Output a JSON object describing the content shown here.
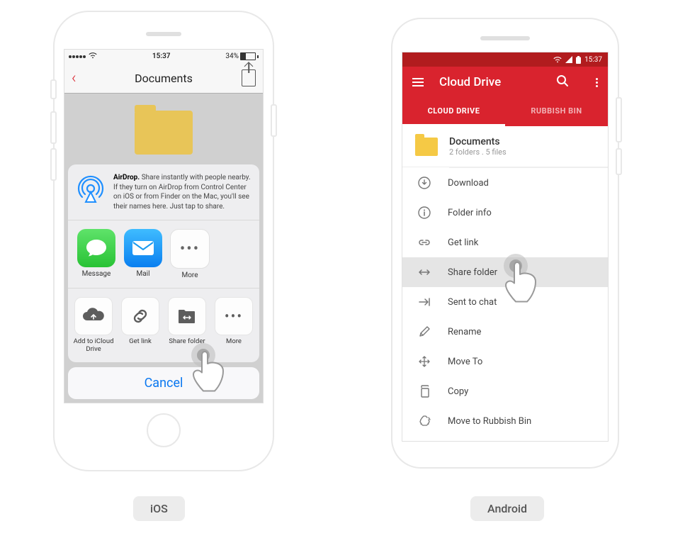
{
  "ios": {
    "status": {
      "time": "15:37",
      "battery": "34%"
    },
    "nav_title": "Documents",
    "airdrop": {
      "bold": "AirDrop.",
      "text": " Share instantly with people nearby. If they turn on AirDrop from Control Center on iOS or from Finder on the Mac, you'll see their names here. Just tap to share."
    },
    "apps": {
      "message": "Message",
      "mail": "Mail",
      "more": "More"
    },
    "actions": {
      "icloud": "Add to iCloud Drive",
      "getlink": "Get link",
      "sharefolder": "Share folder",
      "more": "More"
    },
    "cancel": "Cancel"
  },
  "android": {
    "status_time": "15:37",
    "toolbar_title": "Cloud Drive",
    "tabs": {
      "cloud": "CLOUD DRIVE",
      "rubbish": "RUBBISH BIN"
    },
    "folder": {
      "name": "Documents",
      "sub": "2 folders . 5 files"
    },
    "items": {
      "download": "Download",
      "folderinfo": "Folder info",
      "getlink": "Get link",
      "sharefolder": "Share folder",
      "sentto": "Sent to chat",
      "rename": "Rename",
      "moveto": "Move To",
      "copy": "Copy",
      "rubbish": "Move to Rubbish Bin"
    }
  },
  "labels": {
    "ios": "iOS",
    "android": "Android"
  }
}
